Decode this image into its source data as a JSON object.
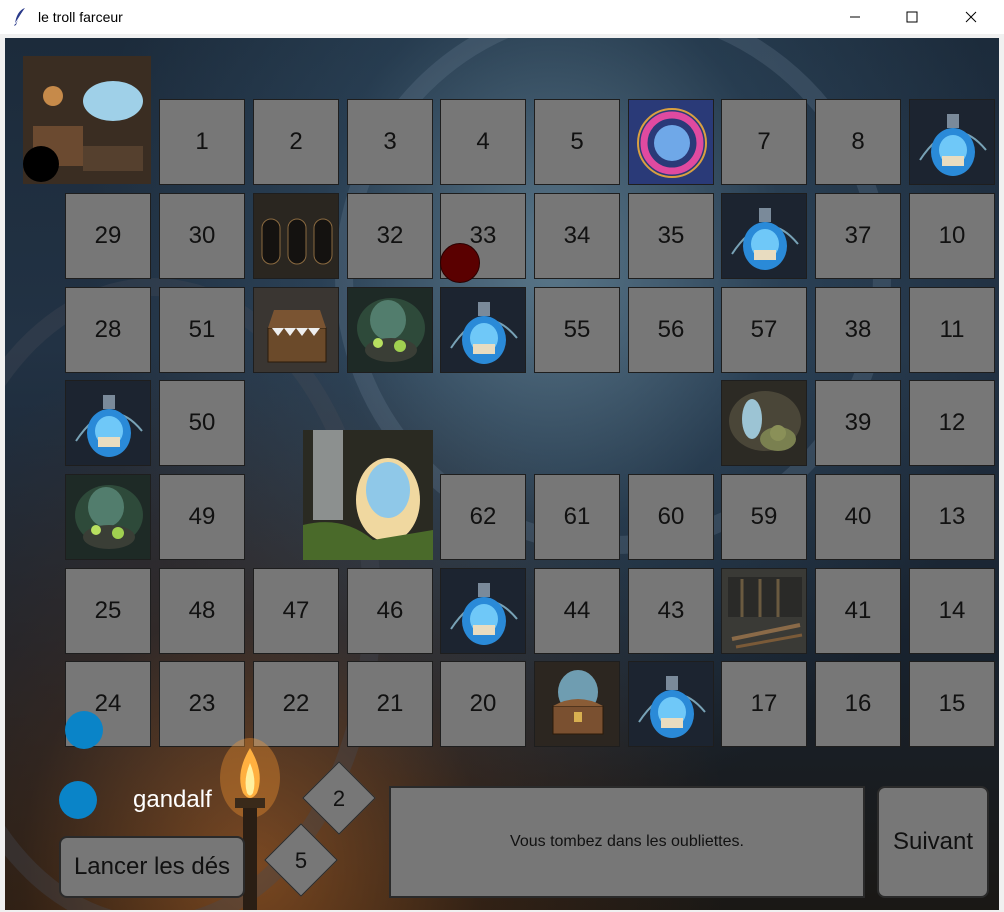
{
  "window": {
    "title": "le troll farceur"
  },
  "icons": {
    "app": "feather-icon",
    "minimize": "minimize-icon",
    "maximize": "maximize-icon",
    "close": "close-icon"
  },
  "board": {
    "numbered_cells": [
      "1",
      "2",
      "3",
      "4",
      "5",
      "7",
      "8",
      "29",
      "30",
      "32",
      "33",
      "34",
      "35",
      "37",
      "10",
      "28",
      "51",
      "55",
      "56",
      "57",
      "38",
      "11",
      "50",
      "39",
      "12",
      "49",
      "62",
      "61",
      "60",
      "59",
      "40",
      "13",
      "25",
      "48",
      "47",
      "46",
      "44",
      "43",
      "41",
      "14",
      "24",
      "23",
      "22",
      "21",
      "20",
      "17",
      "16",
      "15"
    ],
    "image_cells": [
      "kitchen-cave-image",
      "portal-image",
      "potion-image",
      "dungeon-doors-image",
      "potion-image",
      "mimic-chest-image",
      "cauldron-image",
      "potion-image",
      "potion-image",
      "cave-troll-image",
      "cauldron-image",
      "cave-waterfall-image",
      "potion-image",
      "torture-rack-image",
      "treasure-chest-image",
      "potion-image"
    ]
  },
  "player": {
    "name": "gandalf",
    "color": "#0a84c8"
  },
  "opponent": {
    "color": "#5a0000"
  },
  "dice": [
    "2",
    "5"
  ],
  "buttons": {
    "roll": "Lancer les dés",
    "next": "Suivant"
  },
  "message": "Vous tombez dans les oubliettes."
}
